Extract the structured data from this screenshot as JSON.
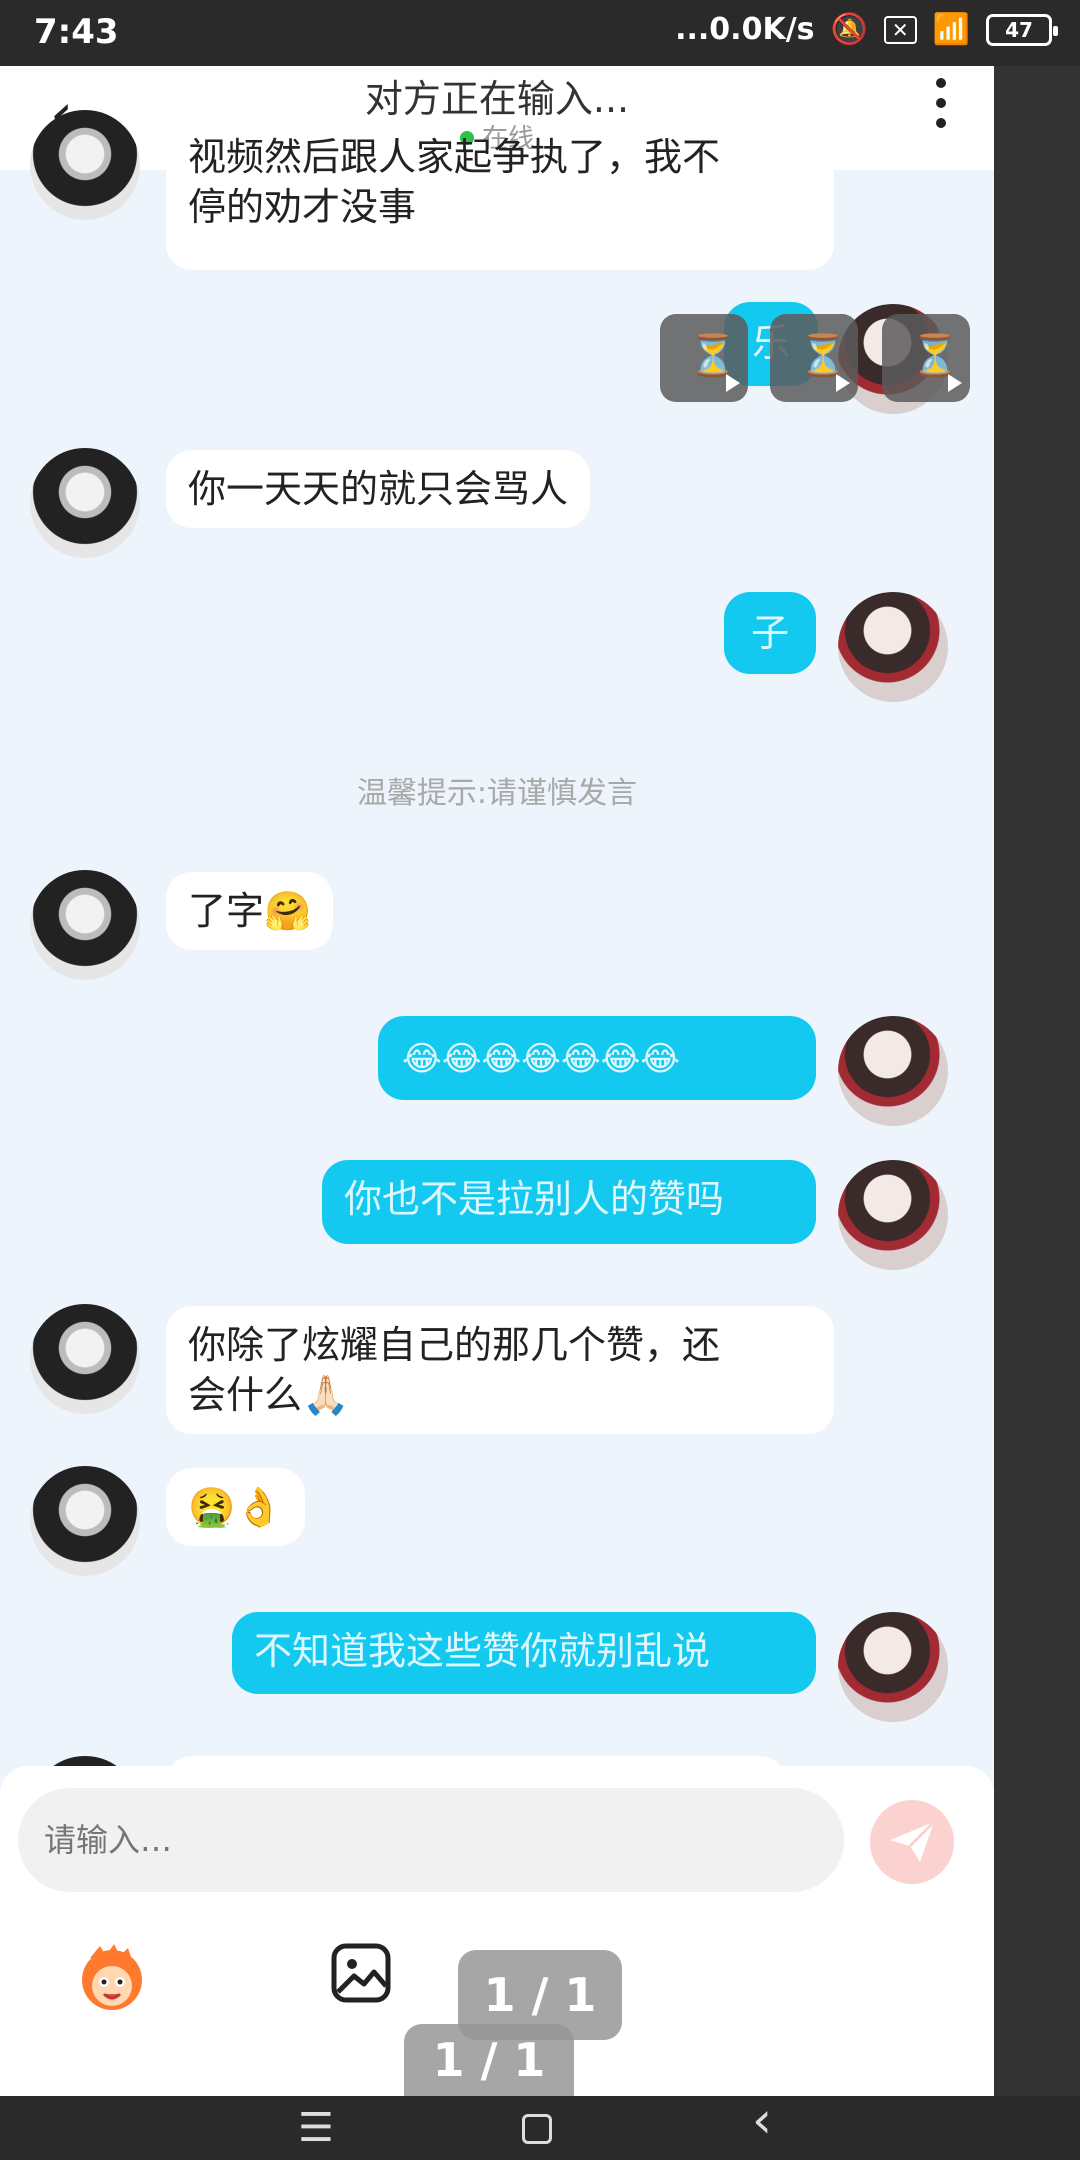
{
  "status_bar": {
    "time": "7:43",
    "network": "...0.0K/s",
    "battery": "47"
  },
  "header": {
    "title": "对方正在输入...",
    "status": "在线"
  },
  "messages": [
    {
      "side": "left",
      "text_line1": "视频然后跟人家起争执了，我不",
      "text_line2": "停的劝才没事"
    },
    {
      "side": "right",
      "text": "乐"
    },
    {
      "side": "left",
      "text": "你一天天的就只会骂人"
    },
    {
      "side": "right",
      "text": "子"
    },
    {
      "side": "left",
      "text": "了字🤗"
    },
    {
      "side": "right",
      "text": "😂😂😂😂😂😂😂"
    },
    {
      "side": "right",
      "text": "你也不是拉别人的赞吗"
    },
    {
      "side": "left",
      "text_line1": "你除了炫耀自己的那几个赞，还",
      "text_line2": "会什么🙏🏻"
    },
    {
      "side": "left",
      "text": "🤮👌"
    },
    {
      "side": "right",
      "text": "不知道我这些赞你就别乱说"
    }
  ],
  "tip": "温馨提示:请谨慎发言",
  "input": {
    "placeholder": "请输入…"
  },
  "pager": "1 / 1",
  "icons": {
    "back": "chevron-left-icon",
    "more": "more-vertical-icon",
    "send": "send-icon",
    "emoji": "emoji-face-icon",
    "image": "image-icon",
    "video": "hourglass-play-icon"
  },
  "colors": {
    "right_bubble": "#14c9f0",
    "left_bubble": "#ffffff",
    "background": "#edf4fc",
    "online_dot": "#2ec24d"
  }
}
